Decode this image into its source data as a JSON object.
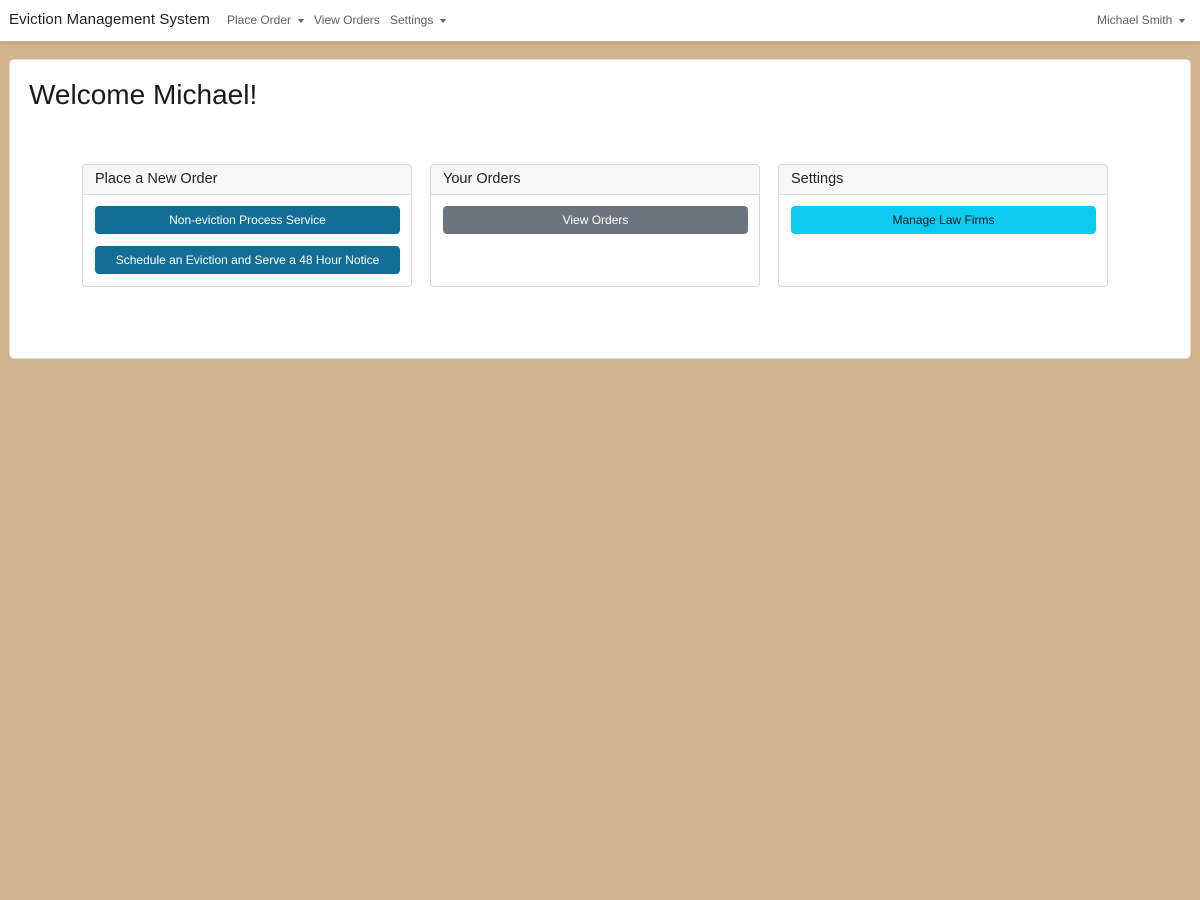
{
  "navbar": {
    "brand": "Eviction Management System",
    "place_order": "Place Order",
    "view_orders": "View Orders",
    "settings": "Settings",
    "user": "Michael Smith"
  },
  "main": {
    "welcome": "Welcome Michael!",
    "panels": [
      {
        "title": "Place a New Order",
        "buttons": [
          "Non-eviction Process Service",
          "Schedule an Eviction and Serve a 48 Hour Notice"
        ]
      },
      {
        "title": "Your Orders",
        "buttons": [
          "View Orders"
        ]
      },
      {
        "title": "Settings",
        "buttons": [
          "Manage Law Firms"
        ]
      }
    ]
  },
  "colors": {
    "page_background": "#d2b48c",
    "primary_button": "#126e94",
    "secondary_button": "#6c757d",
    "info_button": "#0dcaf0"
  },
  "icons": {
    "dropdown": "caret-down-icon"
  }
}
